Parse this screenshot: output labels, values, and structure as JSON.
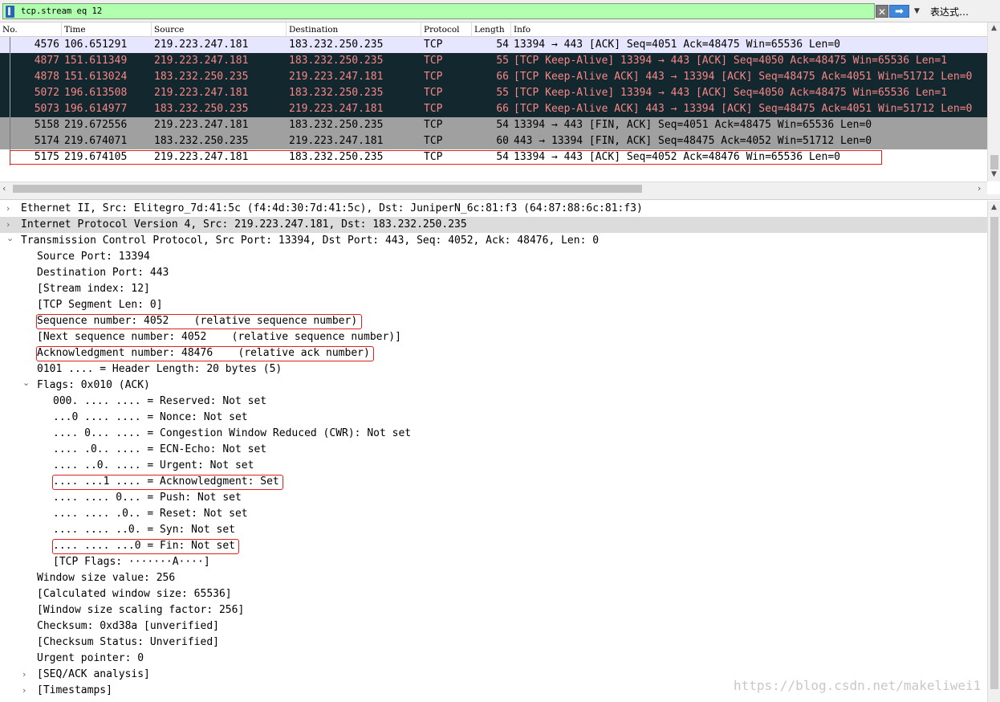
{
  "filter": {
    "value": "tcp.stream eq 12",
    "clear_icon": "✕",
    "apply_icon": "➡",
    "dropdown_icon": "▼",
    "expression_label": "表达式…"
  },
  "columns": [
    "No.",
    "Time",
    "Source",
    "Destination",
    "Protocol",
    "Length",
    "Info"
  ],
  "packets": [
    {
      "no": "4576",
      "time": "106.651291",
      "src": "219.223.247.181",
      "dst": "183.232.250.235",
      "proto": "TCP",
      "len": "54",
      "info": "13394 → 443 [ACK] Seq=4051 Ack=48475 Win=65536 Len=0",
      "style": "normal"
    },
    {
      "no": "4877",
      "time": "151.611349",
      "src": "219.223.247.181",
      "dst": "183.232.250.235",
      "proto": "TCP",
      "len": "55",
      "info": "[TCP Keep-Alive] 13394 → 443 [ACK] Seq=4050 Ack=48475 Win=65536 Len=1",
      "style": "dark"
    },
    {
      "no": "4878",
      "time": "151.613024",
      "src": "183.232.250.235",
      "dst": "219.223.247.181",
      "proto": "TCP",
      "len": "66",
      "info": "[TCP Keep-Alive ACK] 443 → 13394 [ACK] Seq=48475 Ack=4051 Win=51712 Len=0",
      "style": "dark"
    },
    {
      "no": "5072",
      "time": "196.613508",
      "src": "219.223.247.181",
      "dst": "183.232.250.235",
      "proto": "TCP",
      "len": "55",
      "info": "[TCP Keep-Alive] 13394 → 443 [ACK] Seq=4050 Ack=48475 Win=65536 Len=1",
      "style": "dark"
    },
    {
      "no": "5073",
      "time": "196.614977",
      "src": "183.232.250.235",
      "dst": "219.223.247.181",
      "proto": "TCP",
      "len": "66",
      "info": "[TCP Keep-Alive ACK] 443 → 13394 [ACK] Seq=48475 Ack=4051 Win=51712 Len=0",
      "style": "dark"
    },
    {
      "no": "5158",
      "time": "219.672556",
      "src": "219.223.247.181",
      "dst": "183.232.250.235",
      "proto": "TCP",
      "len": "54",
      "info": "13394 → 443 [FIN, ACK] Seq=4051 Ack=48475 Win=65536 Len=0",
      "style": "gray"
    },
    {
      "no": "5174",
      "time": "219.674071",
      "src": "183.232.250.235",
      "dst": "219.223.247.181",
      "proto": "TCP",
      "len": "60",
      "info": "443 → 13394 [FIN, ACK] Seq=48475 Ack=4052 Win=51712 Len=0",
      "style": "gray"
    },
    {
      "no": "5175",
      "time": "219.674105",
      "src": "219.223.247.181",
      "dst": "183.232.250.235",
      "proto": "TCP",
      "len": "54",
      "info": "13394 → 443 [ACK] Seq=4052 Ack=48476 Win=65536 Len=0",
      "style": "white",
      "boxed": true
    }
  ],
  "details": [
    {
      "level": 0,
      "expander": "collapsed",
      "text": "Ethernet II, Src: Elitegro_7d:41:5c (f4:4d:30:7d:41:5c), Dst: JuniperN_6c:81:f3 (64:87:88:6c:81:f3)"
    },
    {
      "level": 0,
      "expander": "collapsed",
      "text": "Internet Protocol Version 4, Src: 219.223.247.181, Dst: 183.232.250.235",
      "highlight": true
    },
    {
      "level": 0,
      "expander": "expanded",
      "text": "Transmission Control Protocol, Src Port: 13394, Dst Port: 443, Seq: 4052, Ack: 48476, Len: 0"
    },
    {
      "level": 1,
      "text": "Source Port: 13394"
    },
    {
      "level": 1,
      "text": "Destination Port: 443"
    },
    {
      "level": 1,
      "text": "[Stream index: 12]"
    },
    {
      "level": 1,
      "text": "[TCP Segment Len: 0]"
    },
    {
      "level": 1,
      "text": "Sequence number: 4052    (relative sequence number)",
      "boxed": true
    },
    {
      "level": 1,
      "text": "[Next sequence number: 4052    (relative sequence number)]"
    },
    {
      "level": 1,
      "text": "Acknowledgment number: 48476    (relative ack number)",
      "boxed": true
    },
    {
      "level": 1,
      "text": "0101 .... = Header Length: 20 bytes (5)"
    },
    {
      "level": 1,
      "expander": "expanded",
      "text": "Flags: 0x010 (ACK)"
    },
    {
      "level": 2,
      "text": "000. .... .... = Reserved: Not set"
    },
    {
      "level": 2,
      "text": "...0 .... .... = Nonce: Not set"
    },
    {
      "level": 2,
      "text": ".... 0... .... = Congestion Window Reduced (CWR): Not set"
    },
    {
      "level": 2,
      "text": ".... .0.. .... = ECN-Echo: Not set"
    },
    {
      "level": 2,
      "text": ".... ..0. .... = Urgent: Not set"
    },
    {
      "level": 2,
      "text": ".... ...1 .... = Acknowledgment: Set",
      "boxed": true
    },
    {
      "level": 2,
      "text": ".... .... 0... = Push: Not set"
    },
    {
      "level": 2,
      "text": ".... .... .0.. = Reset: Not set"
    },
    {
      "level": 2,
      "text": ".... .... ..0. = Syn: Not set"
    },
    {
      "level": 2,
      "text": ".... .... ...0 = Fin: Not set",
      "boxed": true
    },
    {
      "level": 2,
      "text": "[TCP Flags: ·······A····]"
    },
    {
      "level": 1,
      "text": "Window size value: 256"
    },
    {
      "level": 1,
      "text": "[Calculated window size: 65536]"
    },
    {
      "level": 1,
      "text": "[Window size scaling factor: 256]"
    },
    {
      "level": 1,
      "text": "Checksum: 0xd38a [unverified]"
    },
    {
      "level": 1,
      "text": "[Checksum Status: Unverified]"
    },
    {
      "level": 1,
      "text": "Urgent pointer: 0"
    },
    {
      "level": 1,
      "expander": "collapsed",
      "text": "[SEQ/ACK analysis]"
    },
    {
      "level": 1,
      "expander": "collapsed",
      "text": "[Timestamps]"
    }
  ],
  "watermark": "https://blog.csdn.net/makeliwei1",
  "colors": {
    "filter_valid": "#afffaf",
    "row_normal": "#e7e6ff",
    "row_dark": "#12272e",
    "row_dark_text": "#f78787",
    "row_gray": "#a0a0a0",
    "annotation_box": "#e0201c"
  }
}
